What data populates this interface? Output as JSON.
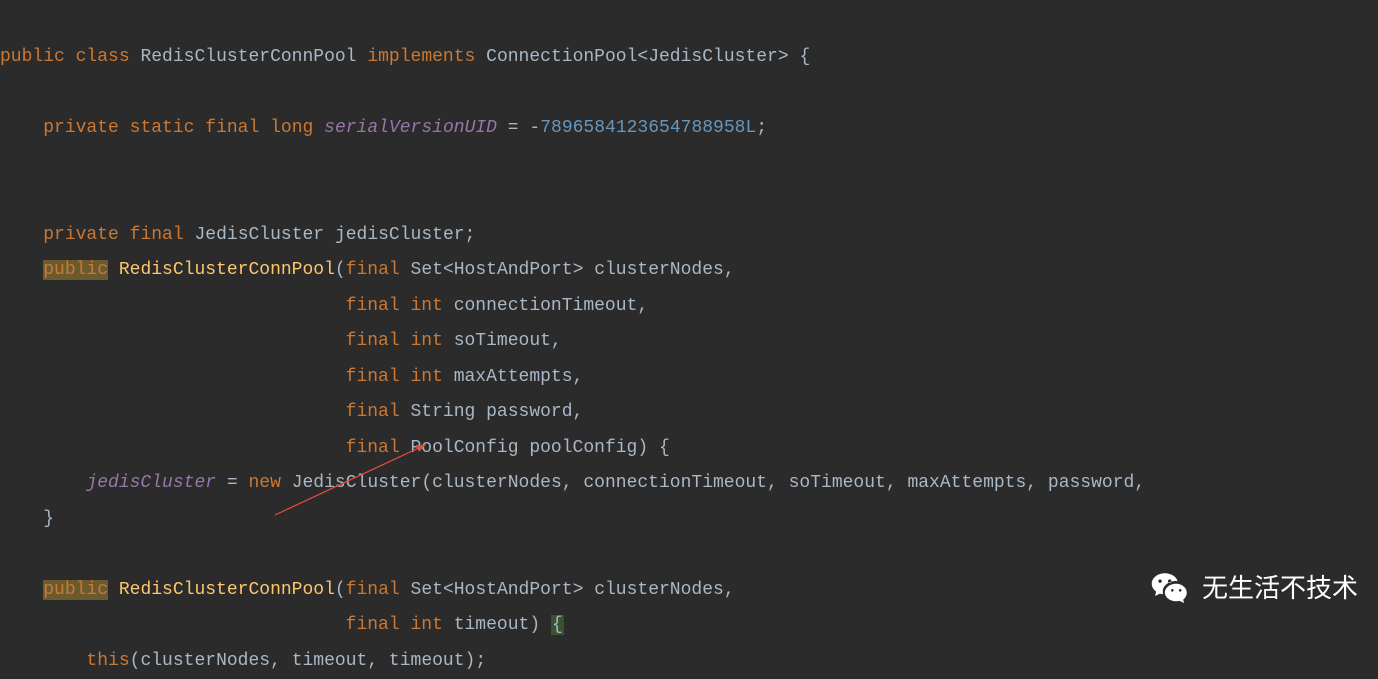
{
  "code": {
    "line1": {
      "kw_public": "public",
      "kw_class": "class",
      "classname": "RedisClusterConnPool",
      "kw_implements": "implements",
      "iface": "ConnectionPool",
      "generic": "JedisCluster",
      "brace": "{"
    },
    "line2": {
      "kw_private": "private",
      "kw_static": "static",
      "kw_final": "final",
      "kw_long": "long",
      "field": "serialVersionUID",
      "eq": "=",
      "neg": "-",
      "num": "7896584123654788958L",
      "semi": ";"
    },
    "line3": {
      "kw_private": "private",
      "kw_final": "final",
      "type": "JedisCluster",
      "field": "jedisCluster",
      "semi": ";"
    },
    "line4": {
      "kw_public": "public",
      "ctor": "RedisClusterConnPool",
      "lparen": "(",
      "kw_final": "final",
      "type": "Set",
      "generic": "HostAndPort",
      "param": "clusterNodes",
      "comma": ","
    },
    "line5": {
      "kw_final": "final",
      "kw_int": "int",
      "param": "connectionTimeout",
      "comma": ","
    },
    "line6": {
      "kw_final": "final",
      "kw_int": "int",
      "param": "soTimeout",
      "comma": ","
    },
    "line7": {
      "kw_final": "final",
      "kw_int": "int",
      "param": "maxAttempts",
      "comma": ","
    },
    "line8": {
      "kw_final": "final",
      "type": "String",
      "param": "password",
      "comma": ","
    },
    "line9": {
      "kw_final": "final",
      "type": "PoolConfig",
      "param": "poolConfig",
      "rparen": ")",
      "brace": "{"
    },
    "line10": {
      "field": "jedisCluster",
      "eq": "=",
      "kw_new": "new",
      "ctor": "JedisCluster",
      "lparen": "(",
      "p1": "clusterNodes",
      "p2": "connectionTimeout",
      "p3": "soTimeout",
      "p4": "maxAttempts",
      "p5": "password",
      "comma": ","
    },
    "line11": {
      "brace": "}"
    },
    "line12": {
      "kw_public": "public",
      "ctor": "RedisClusterConnPool",
      "lparen": "(",
      "kw_final": "final",
      "type": "Set",
      "generic": "HostAndPort",
      "param": "clusterNodes",
      "comma": ","
    },
    "line13": {
      "kw_final": "final",
      "kw_int": "int",
      "param": "timeout",
      "rparen": ")",
      "brace": "{"
    },
    "line14": {
      "kw_this": "this",
      "lparen": "(",
      "p1": "clusterNodes",
      "p2": "timeout",
      "p3": "timeout",
      "rparen": ")",
      "semi": ";"
    }
  },
  "watermark": {
    "text": "无生活不技术"
  }
}
